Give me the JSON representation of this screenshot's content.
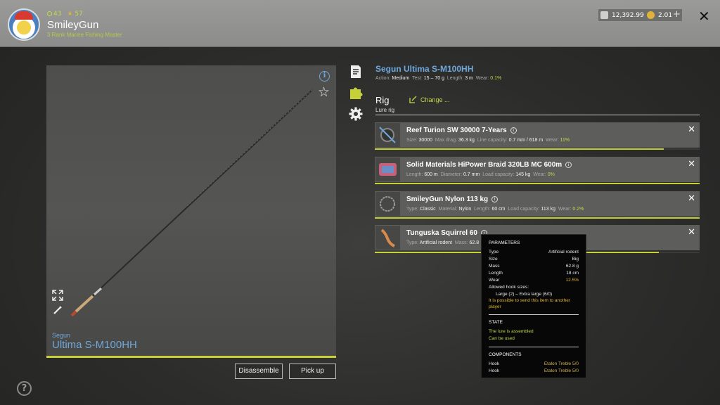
{
  "header": {
    "username": "SmileyGun",
    "rank": "3 Rank Marine Fishing Master",
    "level": "43",
    "stars": "57",
    "silver": "12,392.99",
    "gold": "2.01",
    "add_label": "+",
    "close_label": "✕"
  },
  "rod": {
    "brand": "Segun",
    "model": "Ultima S-M100HH",
    "disassemble_label": "Disassemble",
    "pickup_label": "Pick up",
    "info_label": "i",
    "favorite_label": "☆"
  },
  "item": {
    "title": "Segun Ultima S-M100HH",
    "action_label": "Action:",
    "action": "Medium",
    "test_label": "Test:",
    "test": "15 – 70 g",
    "length_label": "Length:",
    "length": "3 m",
    "wear_label": "Wear:",
    "wear": "0.1%"
  },
  "rig": {
    "title": "Rig",
    "subtitle": "Lure rig",
    "change_label": "Change ..."
  },
  "components": [
    {
      "name": "Reef Turion SW 30000 7-Years",
      "specs": [
        {
          "k": "Size:",
          "v": "30000"
        },
        {
          "k": "Max drag:",
          "v": "36.3 kg"
        },
        {
          "k": "Line capacity:",
          "v": "0.7 mm / 618 m"
        },
        {
          "k": "Wear:",
          "v": "11%"
        }
      ],
      "wear_fraction": 0.89
    },
    {
      "name": "Solid Materials HiPower Braid 320LB MC 600m",
      "specs": [
        {
          "k": "Length:",
          "v": "600 m"
        },
        {
          "k": "Diameter:",
          "v": "0.7 mm"
        },
        {
          "k": "Load capacity:",
          "v": "145 kg"
        },
        {
          "k": "Wear:",
          "v": "0%"
        }
      ],
      "wear_fraction": 1.0
    },
    {
      "name": "SmileyGun Nylon 113 kg",
      "specs": [
        {
          "k": "Type:",
          "v": "Classic"
        },
        {
          "k": "Material:",
          "v": "Nylon"
        },
        {
          "k": "Length:",
          "v": "60 cm"
        },
        {
          "k": "Load capacity:",
          "v": "113 kg"
        },
        {
          "k": "Wear:",
          "v": "0.2%"
        }
      ],
      "wear_fraction": 1.0
    },
    {
      "name": "Tunguska Squirrel 60",
      "specs": [
        {
          "k": "Type:",
          "v": "Artificial rodent"
        },
        {
          "k": "Mass:",
          "v": "62.8"
        }
      ],
      "wear_fraction": 0.875
    }
  ],
  "tooltip": {
    "parameters_header": "PARAMETERS",
    "params": [
      {
        "k": "Type",
        "v": "Artificial rodent"
      },
      {
        "k": "Size",
        "v": "Big"
      },
      {
        "k": "Mass",
        "v": "62.8 g"
      },
      {
        "k": "Length",
        "v": "18 cm"
      },
      {
        "k": "Wear",
        "v": "12.5%"
      }
    ],
    "hook_sizes_label": "Allowed hook sizes:",
    "hook_sizes": "Large (2) – Extra large (6/0)",
    "send_note": "It is possible to send this item to another player",
    "state_header": "STATE",
    "state_lines": [
      "The lure is assembled",
      "Can be used"
    ],
    "components_header": "COMPONENTS",
    "component_rows": [
      {
        "k": "Hook",
        "v": "Etalon Treble 5/0"
      },
      {
        "k": "Hook",
        "v": "Etalon Treble 5/0"
      }
    ]
  },
  "colors": {
    "accent_green": "#c6d649",
    "accent_blue": "#6fa8dc",
    "warning_yellow": "#e3b530"
  },
  "icons": {
    "side": [
      "document-icon",
      "puzzle-icon",
      "gear-icon"
    ],
    "preview": [
      "info-icon",
      "star-icon",
      "expand-icon",
      "pencil-icon"
    ],
    "help": "help-icon"
  }
}
